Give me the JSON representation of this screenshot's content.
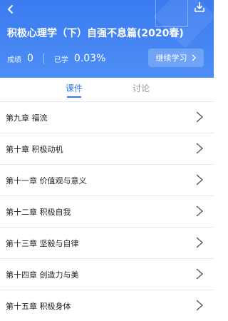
{
  "header": {
    "course_title": "积极心理学（下）自强不息篇(2020春)",
    "score_label": "成绩",
    "score_value": "0",
    "learned_label": "已学",
    "learned_value": "0.03%",
    "continue_label": "继续学习",
    "colors": {
      "gradient_start": "#3a7bf0",
      "gradient_end": "#4e8ef5"
    },
    "icons": {
      "back": "back-arrow-icon",
      "download": "download-icon"
    }
  },
  "tabs": [
    {
      "label": "课件",
      "active": true
    },
    {
      "label": "讨论",
      "active": false
    }
  ],
  "accent_color": "#2f7bf2",
  "chapters": [
    {
      "label": "第九章 福流"
    },
    {
      "label": "第十章 积极动机"
    },
    {
      "label": "第十一章 价值观与意义"
    },
    {
      "label": "第十二章 积极自我"
    },
    {
      "label": "第十三章 坚毅与自律"
    },
    {
      "label": "第十四章 创造力与美"
    },
    {
      "label": "第十五章 积极身体"
    }
  ]
}
